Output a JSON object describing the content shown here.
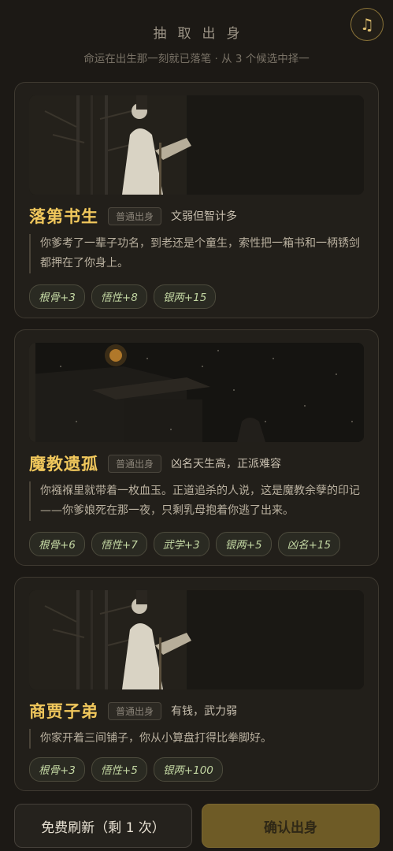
{
  "header": {
    "title": "抽取出身",
    "subtitle": "命运在出生那一刻就已落笔 · 从 3 个候选中择一",
    "music_icon": "♫"
  },
  "cards": [
    {
      "name": "落第书生",
      "tag": "普通出身",
      "trait": "文弱但智计多",
      "description": "你爹考了一辈子功名，到老还是个童生，索性把一箱书和一柄锈剑都押在了你身上。",
      "image": "scholar-bamboo-illustration",
      "stats": [
        "根骨+3",
        "悟性+8",
        "银两+15"
      ]
    },
    {
      "name": "魔教遗孤",
      "tag": "普通出身",
      "trait": "凶名天生高，正派难容",
      "description": "你襁褓里就带着一枚血玉。正道追杀的人说，这是魔教余孽的印记——你爹娘死在那一夜，只剩乳母抱着你逃了出来。",
      "image": "snowy-night-lantern-illustration",
      "stats": [
        "根骨+6",
        "悟性+7",
        "武学+3",
        "银两+5",
        "凶名+15"
      ]
    },
    {
      "name": "商贾子弟",
      "tag": "普通出身",
      "trait": "有钱，武力弱",
      "description": "你家开着三间铺子，你从小算盘打得比拳脚好。",
      "image": "scholar-bamboo-illustration",
      "stats": [
        "根骨+3",
        "悟性+5",
        "银两+100"
      ]
    }
  ],
  "footer": {
    "refresh_label": "免费刷新（剩 1 次）",
    "confirm_label": "确认出身"
  },
  "colors": {
    "background": "#1c1915",
    "accent_gold": "#f0c75c",
    "stat_green": "#c2d6a2",
    "confirm_button": "#6e5b26"
  }
}
